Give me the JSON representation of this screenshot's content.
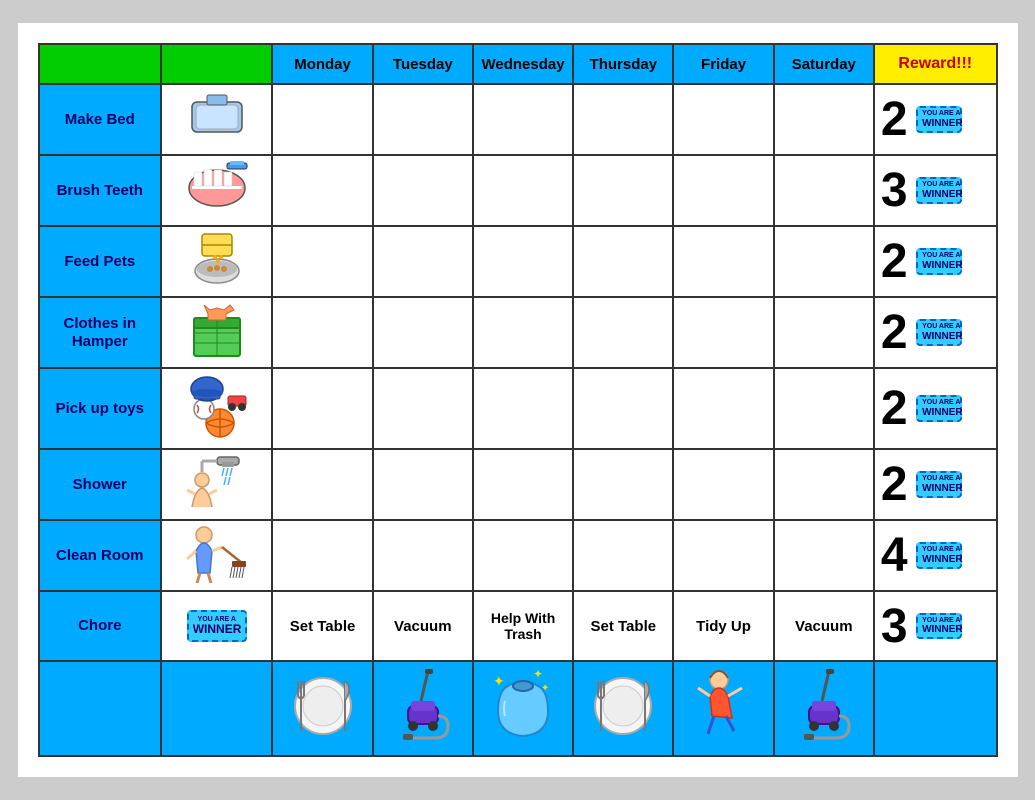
{
  "header": {
    "chore_label": "",
    "icon_label": "",
    "days": [
      "Monday",
      "Tuesday",
      "Wednesday",
      "Thursday",
      "Friday",
      "Saturday"
    ],
    "reward_label": "Reward!!!"
  },
  "rows": [
    {
      "chore": "Make Bed",
      "reward_num": "2",
      "days_filled": []
    },
    {
      "chore": "Brush Teeth",
      "reward_num": "3",
      "days_filled": []
    },
    {
      "chore": "Feed Pets",
      "reward_num": "2",
      "days_filled": []
    },
    {
      "chore": "Clothes in Hamper",
      "reward_num": "2",
      "days_filled": []
    },
    {
      "chore": "Pick up toys",
      "reward_num": "2",
      "days_filled": []
    },
    {
      "chore": "Shower",
      "reward_num": "2",
      "days_filled": []
    },
    {
      "chore": "Clean Room",
      "reward_num": "4",
      "days_filled": []
    },
    {
      "chore": "Chore",
      "reward_num": "3",
      "days_filled": [
        "Set Table",
        "Vacuum",
        "Help With Trash",
        "Set Table",
        "Tidy Up",
        "Vacuum"
      ]
    }
  ],
  "ticket_text": {
    "line1": "YOU ARE A",
    "line2": "WINNER"
  }
}
